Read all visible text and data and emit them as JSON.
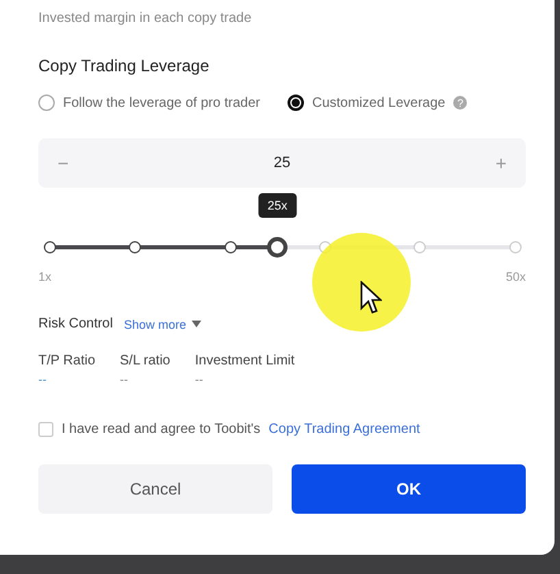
{
  "hint": "Invested margin in each copy trade",
  "section_title": "Copy Trading Leverage",
  "leverage_options": [
    {
      "label": "Follow the leverage of pro trader",
      "selected": false
    },
    {
      "label": "Customized Leverage",
      "selected": true,
      "help": "?"
    }
  ],
  "stepper": {
    "minus": "−",
    "value": "25",
    "plus": "+"
  },
  "slider": {
    "level": 0.49,
    "tooltip": "25x",
    "min_label": "1x",
    "max_label": "50x"
  },
  "risk_control": {
    "title": "Risk Control",
    "toggle": "Show more",
    "expanded": false,
    "columns": [
      {
        "label": "T/P Ratio",
        "value": "--",
        "color": "#4a90c8"
      },
      {
        "label": "S/L ratio",
        "value": "--",
        "color": "#888888"
      },
      {
        "label": "Investment Limit",
        "value": "--",
        "color": "#888888"
      }
    ]
  },
  "agreement": {
    "checked": false,
    "text": "I have read and agree to Toobit's",
    "link": "Copy Trading Agreement"
  },
  "buttons": [
    {
      "label": "Cancel",
      "kind": "secondary"
    },
    {
      "label": "OK",
      "kind": "primary"
    }
  ]
}
